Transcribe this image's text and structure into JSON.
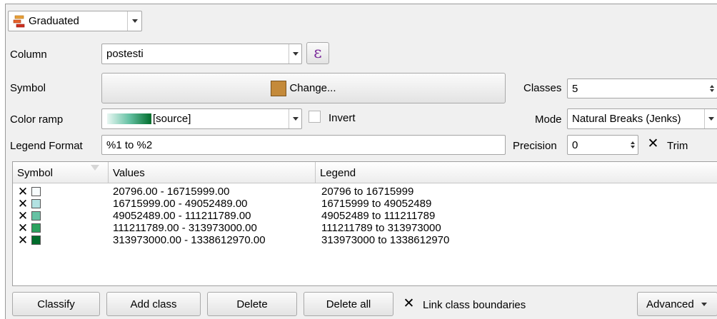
{
  "renderer": {
    "label": "Graduated",
    "icon": "graduated-renderer-icon"
  },
  "column": {
    "label": "Column",
    "value": "postesti",
    "expression_icon": "epsilon-icon",
    "expression_glyph": "ε"
  },
  "symbol": {
    "label": "Symbol",
    "button": "Change...",
    "color": "#c48a3a"
  },
  "classes": {
    "label": "Classes",
    "value": "5"
  },
  "color_ramp": {
    "label": "Color ramp",
    "value": "[source]",
    "ramp_start": "#e8f7f3",
    "ramp_end": "#006d2c"
  },
  "invert": {
    "label": "Invert",
    "checked": false
  },
  "mode": {
    "label": "Mode",
    "value": "Natural Breaks (Jenks)"
  },
  "legend_format": {
    "label": "Legend Format",
    "value": "%1 to %2"
  },
  "precision": {
    "label": "Precision",
    "value": "0"
  },
  "trim": {
    "label": "Trim",
    "checked": true
  },
  "table": {
    "headers": {
      "symbol": "Symbol",
      "values": "Values",
      "legend": "Legend"
    },
    "rows": [
      {
        "checked": true,
        "color": "#f7fcfd",
        "values": "20796.00 - 16715999.00",
        "legend": "20796 to 16715999"
      },
      {
        "checked": true,
        "color": "#b2e2e2",
        "values": "16715999.00 - 49052489.00",
        "legend": "16715999 to 49052489"
      },
      {
        "checked": true,
        "color": "#66c2a4",
        "values": "49052489.00 - 111211789.00",
        "legend": "49052489 to 111211789"
      },
      {
        "checked": true,
        "color": "#2ca25f",
        "values": "111211789.00 - 313973000.00",
        "legend": "111211789 to 313973000"
      },
      {
        "checked": true,
        "color": "#006d2c",
        "values": "313973000.00 - 1338612970.00",
        "legend": "313973000 to 1338612970"
      }
    ]
  },
  "buttons": {
    "classify": "Classify",
    "add_class": "Add class",
    "delete": "Delete",
    "delete_all": "Delete all",
    "link_label": "Link class boundaries",
    "link_checked": true,
    "advanced": "Advanced"
  },
  "check_glyph": "✕"
}
